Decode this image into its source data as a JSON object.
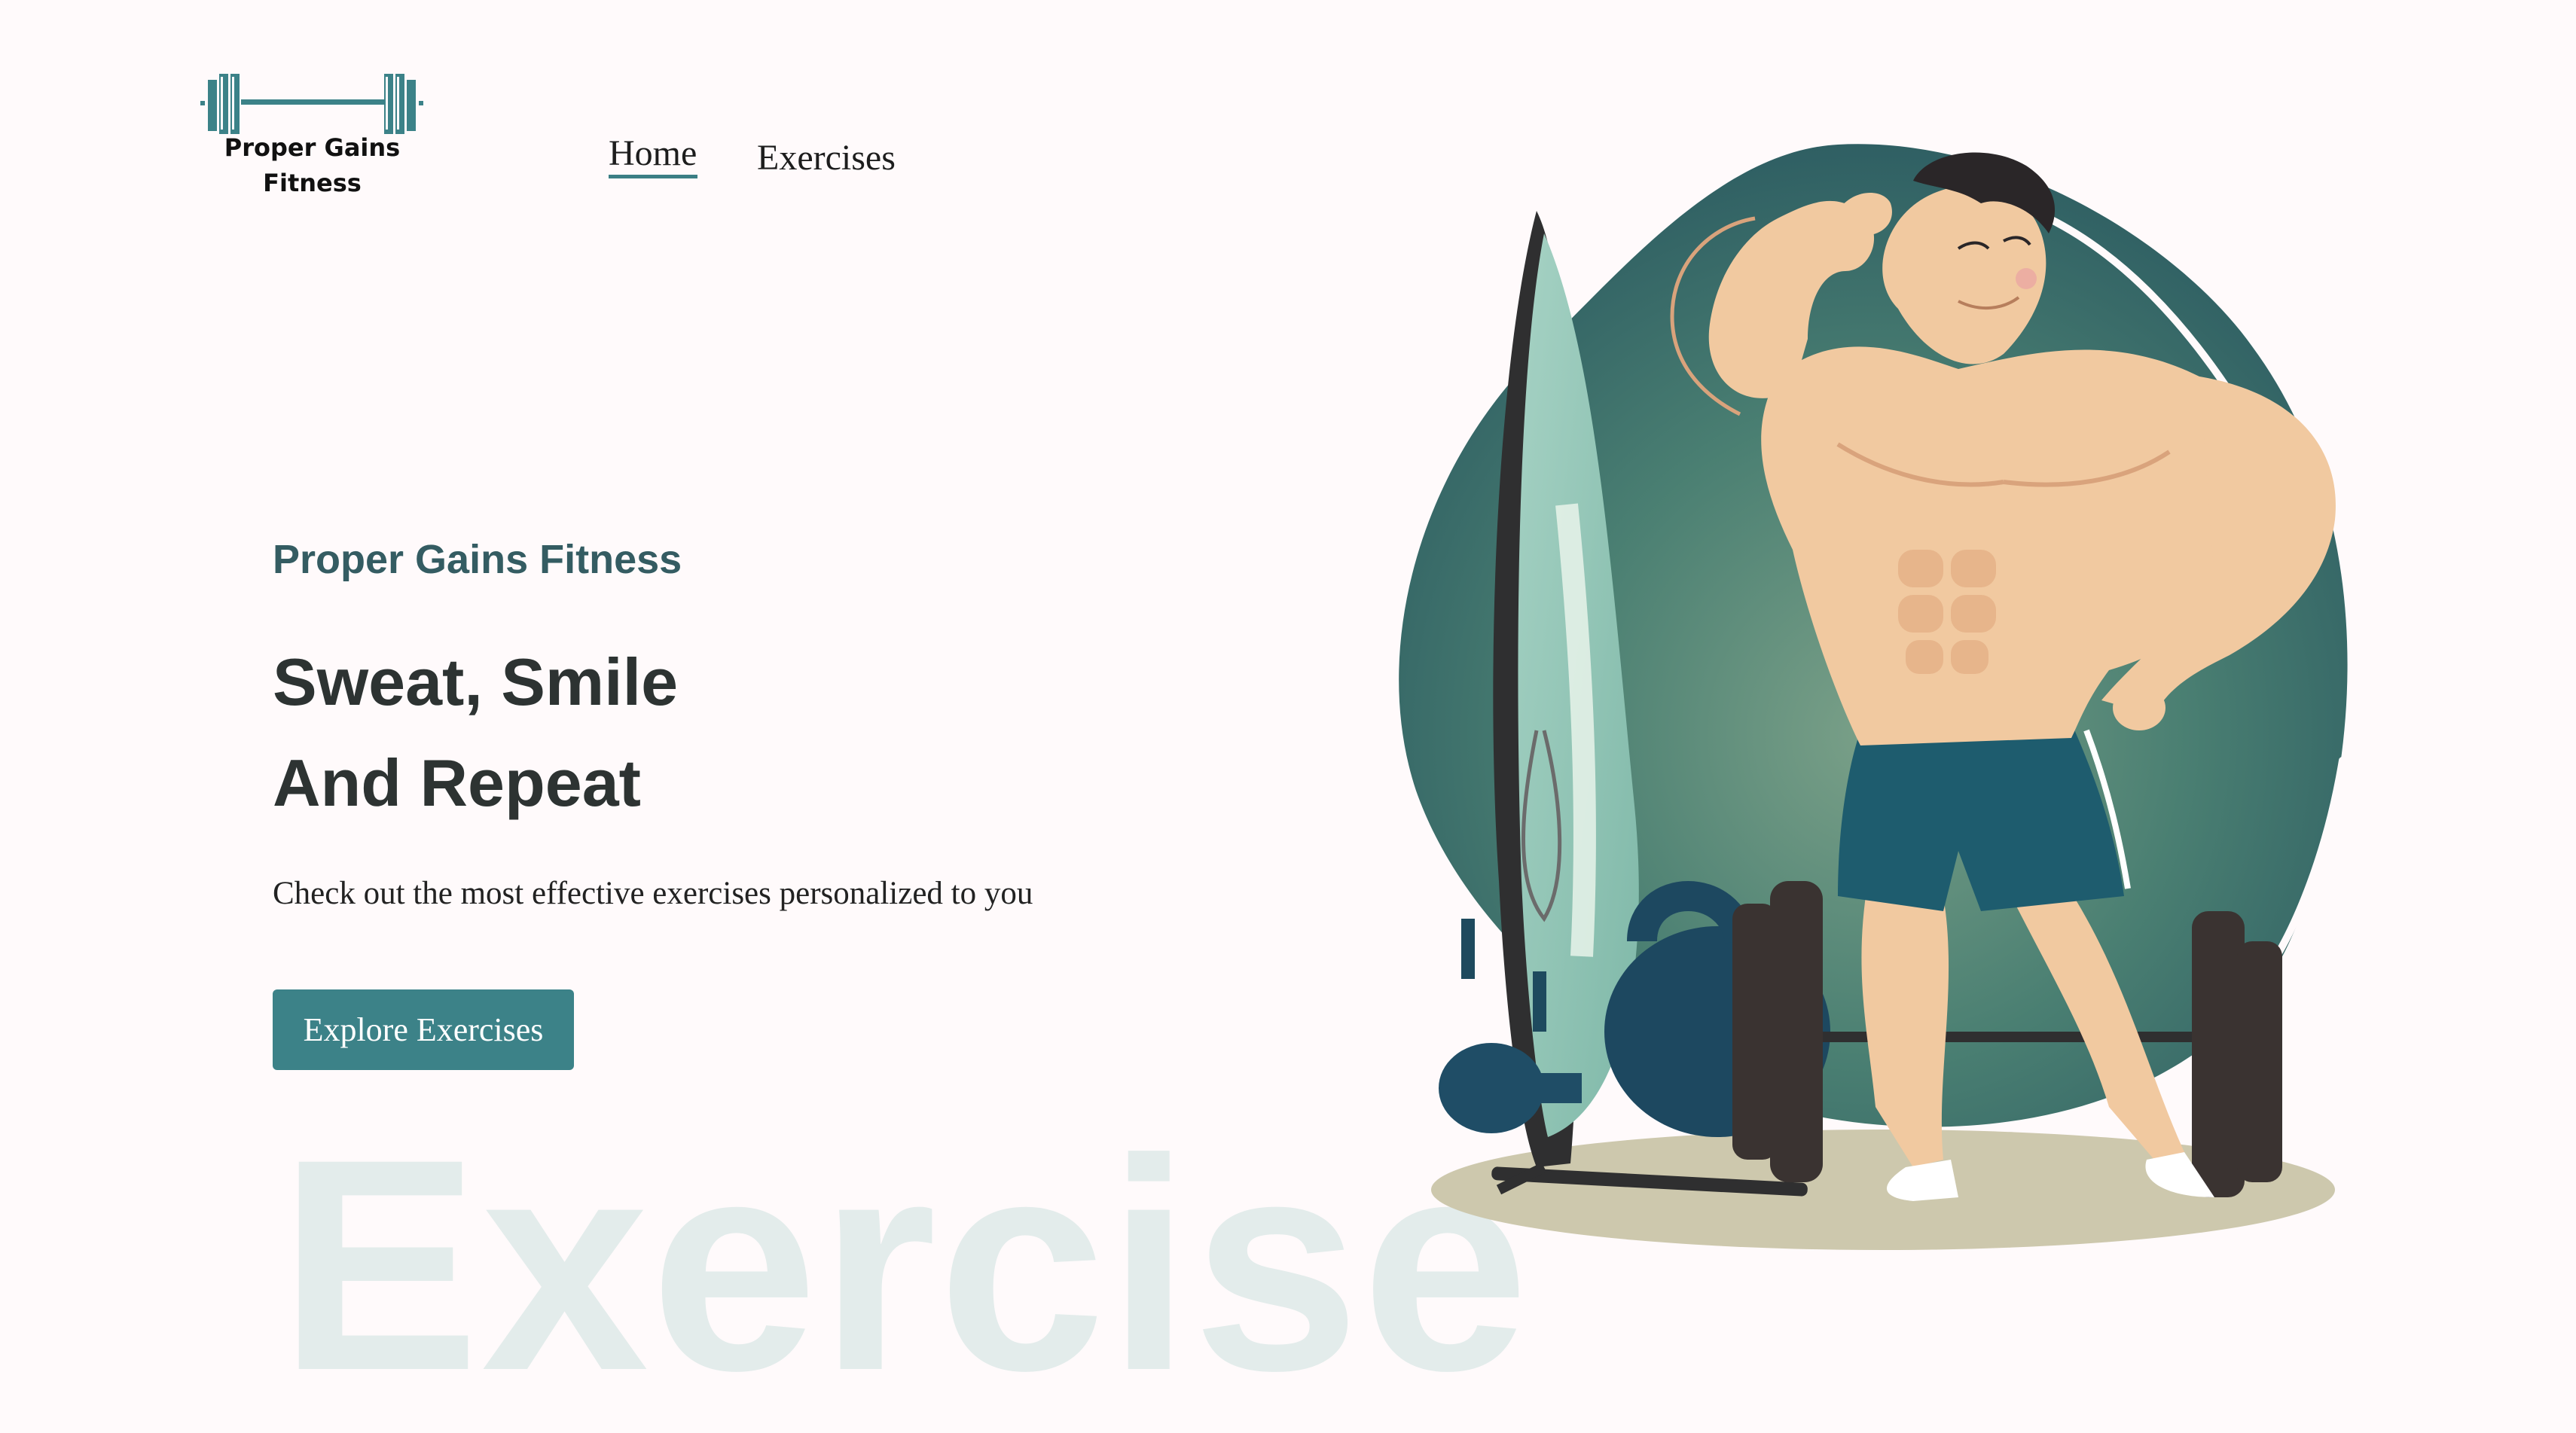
{
  "brand": {
    "logo_line1": "Proper Gains",
    "logo_line2": "Fitness",
    "accent_color": "#3c8288"
  },
  "nav": {
    "items": [
      {
        "label": "Home",
        "active": true
      },
      {
        "label": "Exercises",
        "active": false
      }
    ]
  },
  "hero": {
    "eyebrow": "Proper Gains Fitness",
    "headline_line1": "Sweat, Smile",
    "headline_line2": "And Repeat",
    "subtext": "Check out the most effective exercises personalized to you",
    "cta_label": "Explore Exercises",
    "watermark": "Exercise"
  },
  "illustration": {
    "icon": "bodybuilder-illustration"
  }
}
